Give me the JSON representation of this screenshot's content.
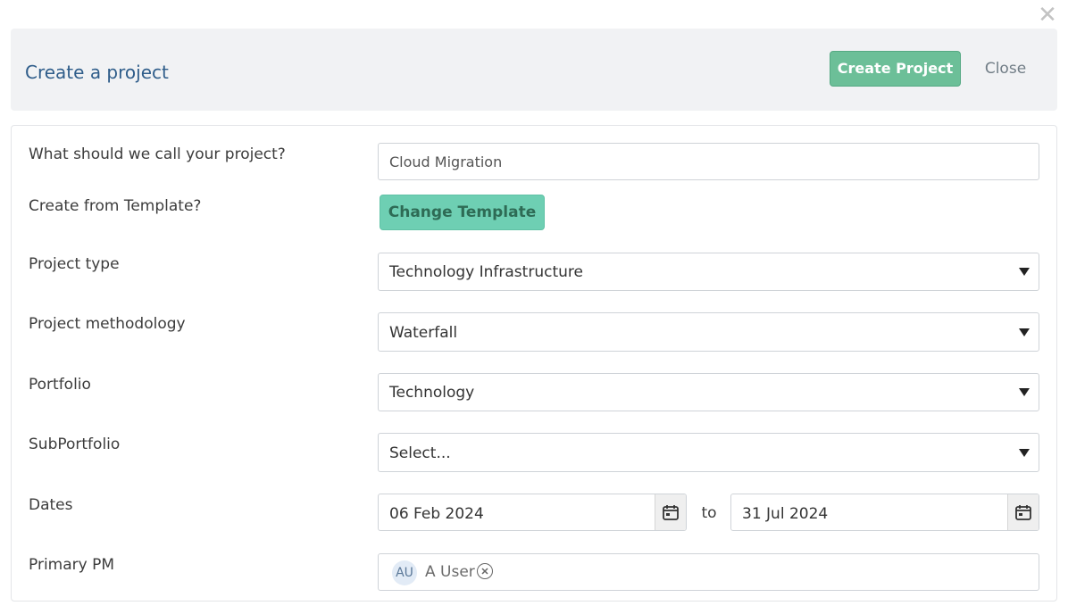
{
  "dialog": {
    "close_glyph": "✕",
    "title": "Create a project",
    "create_label": "Create Project",
    "close_label": "Close"
  },
  "form": {
    "name": {
      "label": "What should we call your project?",
      "value": "Cloud Migration"
    },
    "template": {
      "label": "Create from Template?",
      "button_label": "Change Template"
    },
    "project_type": {
      "label": "Project type",
      "value": "Technology Infrastructure"
    },
    "methodology": {
      "label": "Project methodology",
      "value": "Waterfall"
    },
    "portfolio": {
      "label": "Portfolio",
      "value": "Technology"
    },
    "subportfolio": {
      "label": "SubPortfolio",
      "value": "Select..."
    },
    "dates": {
      "label": "Dates",
      "start": "06 Feb 2024",
      "separator": "to",
      "end": "31 Jul 2024"
    },
    "primary_pm": {
      "label": "Primary PM",
      "initials": "AU",
      "name": "A User"
    }
  },
  "icons": {
    "calendar": "calendar-icon",
    "remove": "remove-circle-icon",
    "dropdown": "caret-down-icon"
  },
  "colors": {
    "primary_button": "#6cbf98",
    "template_button": "#6ecfb3",
    "title": "#2f5d8a",
    "header_bg": "#f1f2f4"
  }
}
